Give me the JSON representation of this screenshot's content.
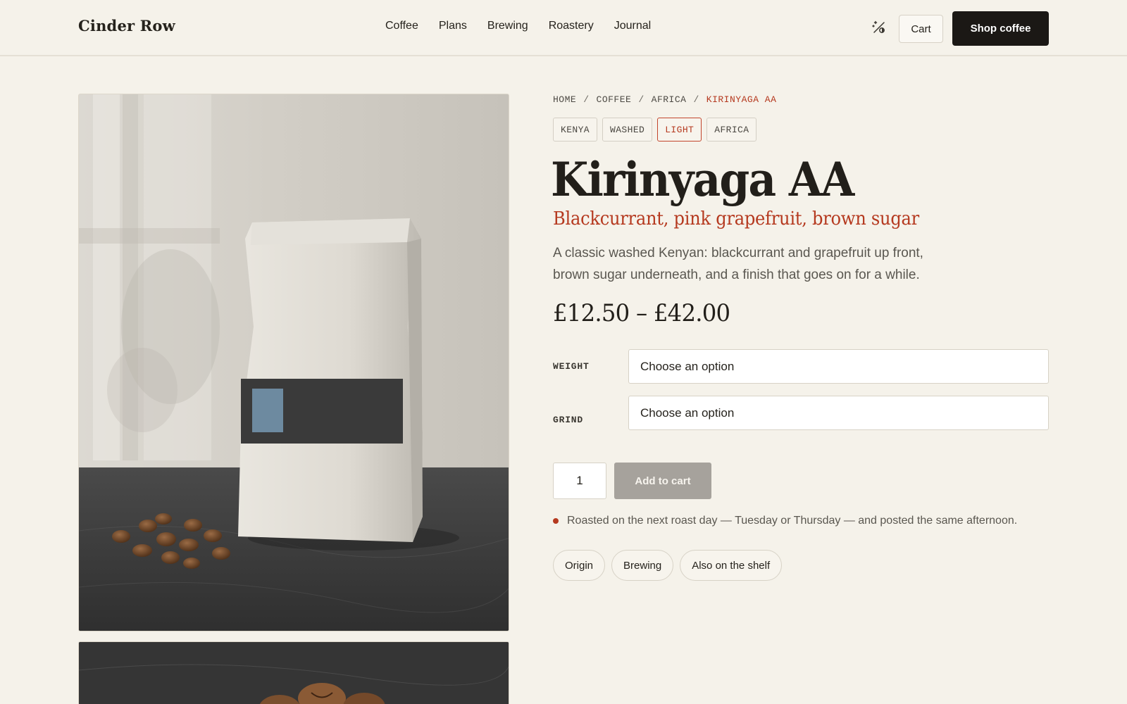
{
  "header": {
    "logo": "Cinder Row",
    "nav": [
      "Coffee",
      "Plans",
      "Brewing",
      "Roastery",
      "Journal"
    ],
    "theme_toggle_icon": "theme-toggle-icon",
    "cart_label": "Cart",
    "shop_label": "Shop coffee"
  },
  "breadcrumb": {
    "items": [
      "HOME",
      "COFFEE",
      "AFRICA"
    ],
    "separator": "/",
    "current": "KIRINYAGA AA"
  },
  "tags": [
    {
      "label": "KENYA",
      "active": false
    },
    {
      "label": "WASHED",
      "active": false
    },
    {
      "label": "LIGHT",
      "active": true
    },
    {
      "label": "AFRICA",
      "active": false
    }
  ],
  "product": {
    "title": "Kirinyaga AA",
    "tasting_notes": "Blackcurrant, pink grapefruit, brown sugar",
    "description": "A classic washed Kenyan: blackcurrant and grapefruit up front, brown sugar underneath, and a finish that goes on for a while.",
    "price": "£12.50 – £42.00"
  },
  "options": {
    "weight": {
      "label": "WEIGHT",
      "placeholder": "Choose an option"
    },
    "grind": {
      "label": "GRIND",
      "placeholder": "Choose an option"
    }
  },
  "purchase": {
    "quantity": "1",
    "add_to_cart": "Add to cart",
    "roast_note": "Roasted on the next roast day — Tuesday or Thursday — and posted the same afternoon."
  },
  "info_tabs": [
    "Origin",
    "Brewing",
    "Also on the shelf"
  ],
  "colors": {
    "background": "#f5f2ea",
    "accent": "#b5391f",
    "primary_button": "#1b1815",
    "disabled_button": "#a6a29c"
  }
}
